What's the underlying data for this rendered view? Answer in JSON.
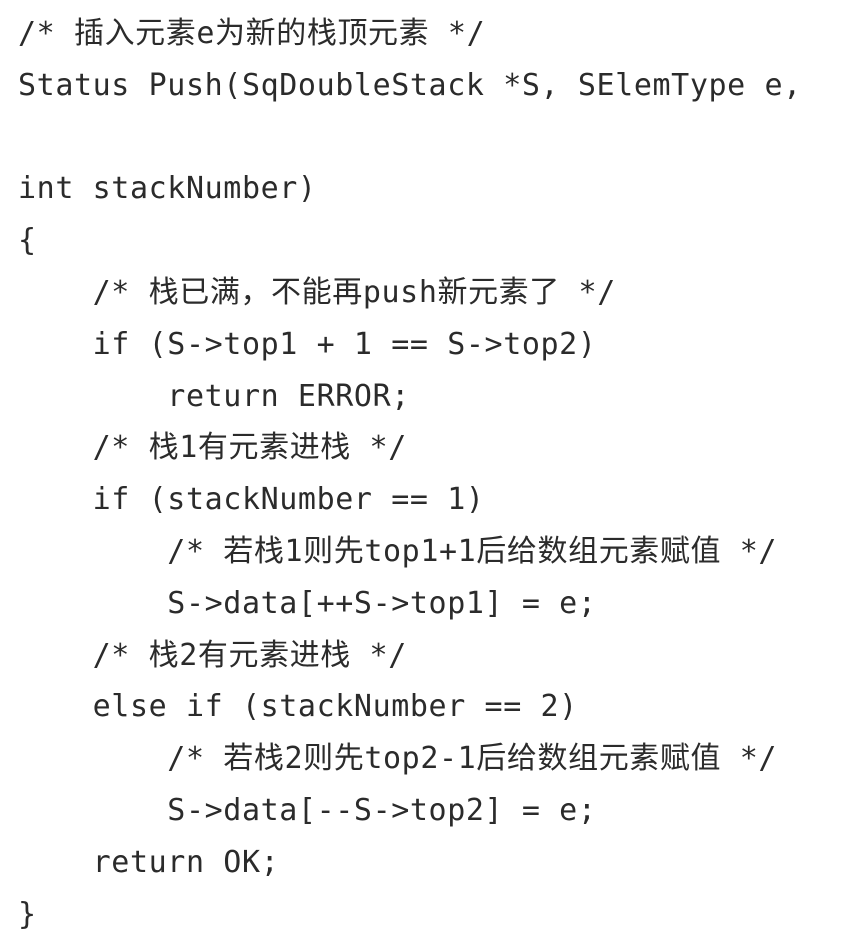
{
  "code": {
    "lines": [
      "/* 插入元素e为新的栈顶元素 */",
      "Status Push(SqDoubleStack *S, SElemType e,",
      "",
      "int stackNumber)",
      "{",
      "    /* 栈已满，不能再push新元素了 */",
      "    if (S->top1 + 1 == S->top2)",
      "        return ERROR;",
      "    /* 栈1有元素进栈 */",
      "    if (stackNumber == 1)",
      "        /* 若栈1则先top1+1后给数组元素赋值 */",
      "        S->data[++S->top1] = e;",
      "    /* 栈2有元素进栈 */",
      "    else if (stackNumber == 2)",
      "        /* 若栈2则先top2-1后给数组元素赋值 */",
      "        S->data[--S->top2] = e;",
      "    return OK;",
      "}"
    ]
  }
}
